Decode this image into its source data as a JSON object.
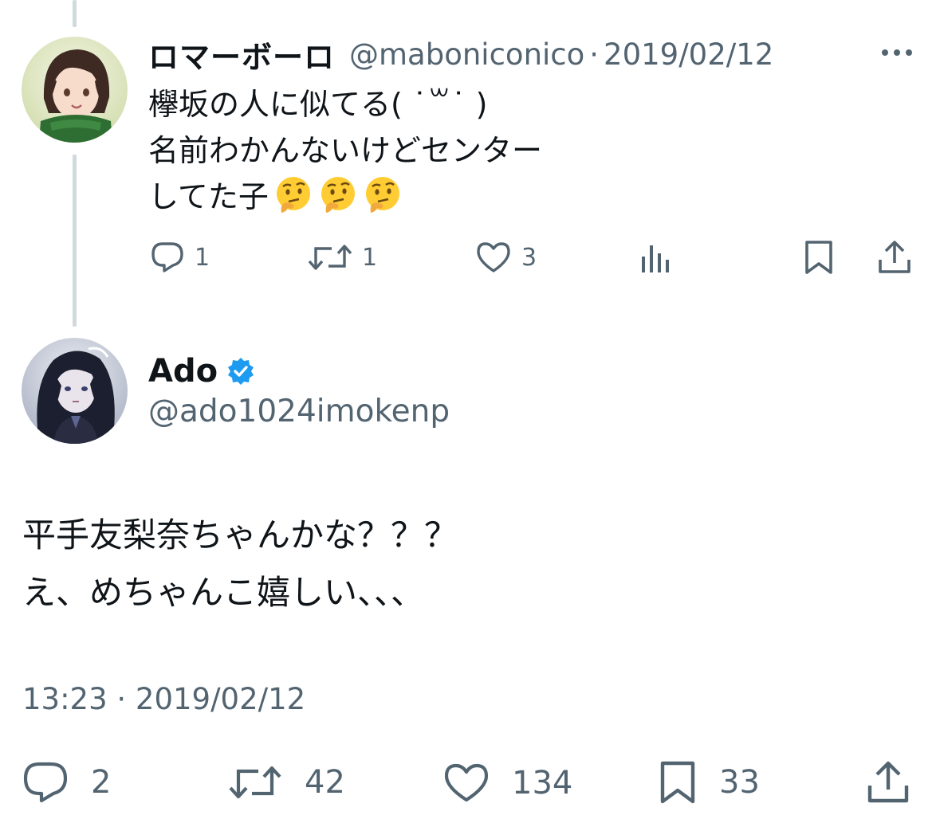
{
  "reply": {
    "display_name": "ロマーボーロ",
    "handle": "@maboniconico",
    "separator": "·",
    "date": "2019/02/12",
    "text_lines": [
      "欅坂の人に似てる( ˙꒳˙ )",
      "名前わかんないけどセンター",
      "してた子"
    ],
    "emoji": [
      "thinking-face",
      "thinking-face",
      "thinking-face"
    ],
    "actions": {
      "replies": "1",
      "retweets": "1",
      "likes": "3"
    },
    "icons": {
      "more": "more-dots-icon",
      "reply": "reply-bubble-icon",
      "retweet": "retweet-icon",
      "like": "heart-icon",
      "views": "views-chart-icon",
      "bookmark": "bookmark-icon",
      "share": "share-icon"
    }
  },
  "main": {
    "display_name": "Ado",
    "verified": true,
    "handle": "@ado1024imokenp",
    "text_lines": [
      "平手友梨奈ちゃんかな？？？",
      "え、めちゃんこ嬉しい、、、"
    ],
    "timestamp": "13:23 · 2019/02/12",
    "actions": {
      "replies": "2",
      "retweets": "42",
      "likes": "134",
      "bookmarks": "33"
    }
  },
  "colors": {
    "text_primary": "#0f1419",
    "text_secondary": "#536471",
    "thread_line": "#cfd9de",
    "verified_blue": "#1d9bf0",
    "emoji_yellow": "#ffcc33"
  }
}
